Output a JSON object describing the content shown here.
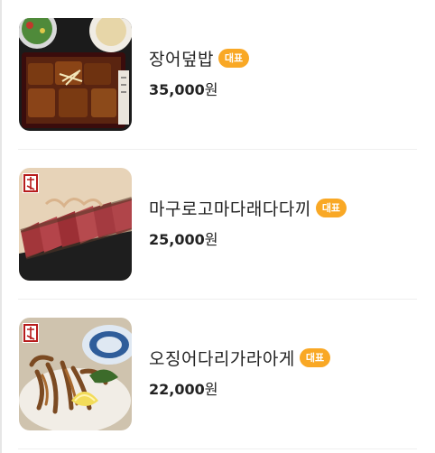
{
  "menu": {
    "items": [
      {
        "name": "장어덮밥",
        "badge": "대표",
        "price_number": "35,000",
        "price_unit": "원",
        "image_icon": "unagi-don-photo"
      },
      {
        "name": "마구로고마다래다다끼",
        "badge": "대표",
        "price_number": "25,000",
        "price_unit": "원",
        "image_icon": "tuna-tataki-photo"
      },
      {
        "name": "오징어다리가라아게",
        "badge": "대표",
        "price_number": "22,000",
        "price_unit": "원",
        "image_icon": "squid-karaage-photo"
      }
    ]
  },
  "colors": {
    "badge_bg": "#f9a825",
    "text": "#222222",
    "divider": "#efefef"
  }
}
